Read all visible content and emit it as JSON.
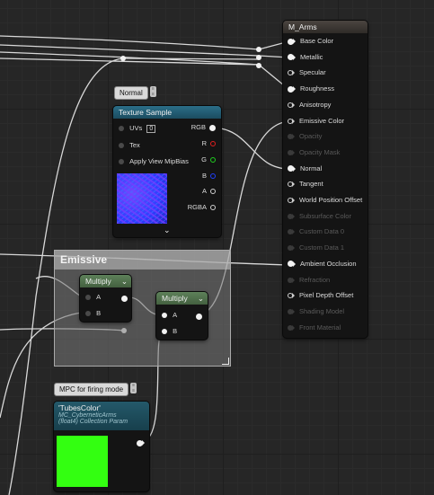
{
  "material_node": {
    "title": "M_Arms",
    "inputs": [
      {
        "label": "Base Color",
        "enabled": true,
        "connected": true
      },
      {
        "label": "Metallic",
        "enabled": true,
        "connected": true
      },
      {
        "label": "Specular",
        "enabled": true,
        "connected": false
      },
      {
        "label": "Roughness",
        "enabled": true,
        "connected": true
      },
      {
        "label": "Anisotropy",
        "enabled": true,
        "connected": false
      },
      {
        "label": "Emissive Color",
        "enabled": true,
        "connected": false
      },
      {
        "label": "Opacity",
        "enabled": false,
        "connected": false
      },
      {
        "label": "Opacity Mask",
        "enabled": false,
        "connected": false
      },
      {
        "label": "Normal",
        "enabled": true,
        "connected": true
      },
      {
        "label": "Tangent",
        "enabled": true,
        "connected": false
      },
      {
        "label": "World Position Offset",
        "enabled": true,
        "connected": false
      },
      {
        "label": "Subsurface Color",
        "enabled": false,
        "connected": false
      },
      {
        "label": "Custom Data 0",
        "enabled": false,
        "connected": false
      },
      {
        "label": "Custom Data 1",
        "enabled": false,
        "connected": false
      },
      {
        "label": "Ambient Occlusion",
        "enabled": true,
        "connected": true
      },
      {
        "label": "Refraction",
        "enabled": false,
        "connected": false
      },
      {
        "label": "Pixel Depth Offset",
        "enabled": true,
        "connected": false
      },
      {
        "label": "Shading Model",
        "enabled": false,
        "connected": false
      },
      {
        "label": "Front Material",
        "enabled": false,
        "connected": false
      }
    ]
  },
  "texture_sample": {
    "comment": "Normal",
    "title": "Texture Sample",
    "inputs": [
      "UVs",
      "Tex",
      "Apply View MipBias"
    ],
    "uv_index": "0",
    "outputs": [
      "RGB",
      "R",
      "G",
      "B",
      "A",
      "RGBA"
    ],
    "colors": {
      "RGB": "#f2f2f2",
      "R": "#e02020",
      "G": "#20d020",
      "B": "#2040ff",
      "A": "#d0d0d0",
      "RGBA": "#d0d0d0"
    }
  },
  "emissive_comment": {
    "title": "Emissive"
  },
  "multiply1": {
    "title": "Multiply",
    "inputs": [
      "A",
      "B"
    ]
  },
  "multiply2": {
    "title": "Multiply",
    "inputs": [
      "A",
      "B"
    ]
  },
  "mpc_node": {
    "comment": "MPC for firing mode",
    "title": "'TubesColor'",
    "sub1": "MC_CyberneticArms",
    "sub2": "(float4) Collection Param",
    "preview_color": "#33ff11"
  },
  "colors": {
    "material_header": "#3a3532",
    "texture_header": "#1f5a73",
    "multiply_header": "#4f6e4b",
    "mpc_header": "#1e4f5e"
  }
}
